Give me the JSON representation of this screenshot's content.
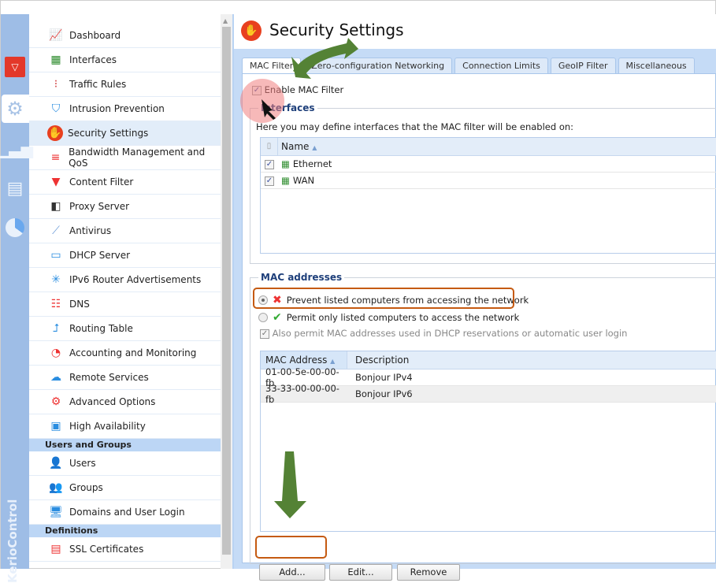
{
  "app": {
    "brand": "KerioControl",
    "title": "Security Settings"
  },
  "rail": [
    {
      "icon": "kerio-shield-icon"
    },
    {
      "icon": "gear-icon",
      "active": true
    },
    {
      "icon": "bar-chart-icon"
    },
    {
      "icon": "log-document-icon"
    },
    {
      "icon": "pie-chart-icon"
    }
  ],
  "nav": {
    "items": [
      {
        "label": "Dashboard",
        "icon": "dashboard-icon"
      },
      {
        "label": "Interfaces",
        "icon": "network-card-icon"
      },
      {
        "label": "Traffic Rules",
        "icon": "traffic-light-icon"
      },
      {
        "label": "Intrusion Prevention",
        "icon": "shield-icon"
      },
      {
        "label": "Security Settings",
        "icon": "stop-hand-icon",
        "active": true
      },
      {
        "label": "Bandwidth Management and QoS",
        "icon": "bandwidth-icon"
      },
      {
        "label": "Content Filter",
        "icon": "funnel-icon"
      },
      {
        "label": "Proxy Server",
        "icon": "proxy-icon"
      },
      {
        "label": "Antivirus",
        "icon": "syringe-icon"
      },
      {
        "label": "DHCP Server",
        "icon": "monitor-clock-icon"
      },
      {
        "label": "IPv6 Router Advertisements",
        "icon": "router-icon"
      },
      {
        "label": "DNS",
        "icon": "hierarchy-icon"
      },
      {
        "label": "Routing Table",
        "icon": "routing-icon"
      },
      {
        "label": "Accounting and Monitoring",
        "icon": "report-icon"
      },
      {
        "label": "Remote Services",
        "icon": "cloud-gear-icon"
      },
      {
        "label": "Advanced Options",
        "icon": "tools-icon"
      },
      {
        "label": "High Availability",
        "icon": "monitors-icon"
      }
    ],
    "users_header": "Users and Groups",
    "users_items": [
      {
        "label": "Users",
        "icon": "user-icon"
      },
      {
        "label": "Groups",
        "icon": "group-icon"
      },
      {
        "label": "Domains and User Login",
        "icon": "user-monitor-icon"
      }
    ],
    "definitions_header": "Definitions",
    "definitions_items": [
      {
        "label": "SSL Certificates",
        "icon": "certificate-icon"
      }
    ]
  },
  "tabs": [
    {
      "label": "MAC Filter",
      "active": true
    },
    {
      "label": "Zero-configuration Networking"
    },
    {
      "label": "Connection Limits"
    },
    {
      "label": "GeoIP Filter"
    },
    {
      "label": "Miscellaneous"
    }
  ],
  "mac_filter": {
    "enable_label": "Enable MAC Filter",
    "enabled": true,
    "interfaces": {
      "legend": "Interfaces",
      "description": "Here you may define interfaces that the MAC filter will be enabled on:",
      "column": "Name",
      "rows": [
        {
          "name": "Ethernet",
          "checked": true
        },
        {
          "name": "WAN",
          "checked": true
        }
      ]
    },
    "mac_addresses": {
      "legend": "MAC addresses",
      "prevent_label": "Prevent listed computers from accessing the network",
      "permit_label": "Permit only listed computers to access the network",
      "selected": "prevent",
      "also_permit_label": "Also permit MAC addresses used in DHCP reservations or automatic user login",
      "also_permit_checked": true,
      "columns": [
        "MAC Address",
        "Description"
      ],
      "rows": [
        {
          "mac": "01-00-5e-00-00-fb",
          "desc": "Bonjour IPv4"
        },
        {
          "mac": "33-33-00-00-00-fb",
          "desc": "Bonjour IPv6"
        }
      ]
    },
    "buttons": {
      "add": "Add...",
      "edit": "Edit...",
      "remove": "Remove"
    }
  },
  "colors": {
    "accent": "#e8401f",
    "annotation_arrow": "#548235",
    "highlight": "#c55a11",
    "rail": "#9ebde6"
  }
}
